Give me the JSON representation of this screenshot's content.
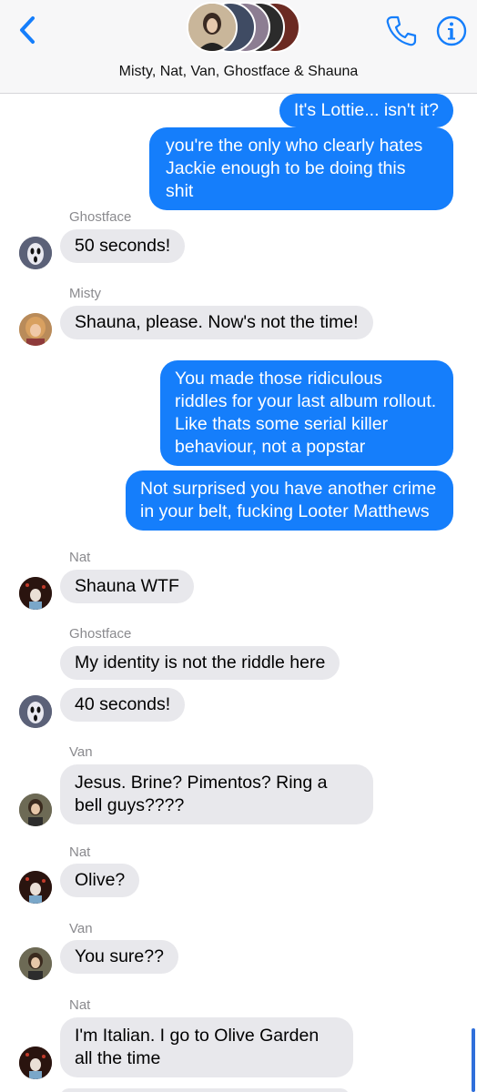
{
  "header": {
    "group_name": "Misty, Nat, Van, Ghostface & Shauna",
    "accent": "#157efb"
  },
  "icons": {
    "back": "chevron-left-icon",
    "phone": "phone-icon",
    "info": "info-icon"
  },
  "colors": {
    "outgoing_bubble": "#157efb",
    "incoming_bubble": "#e8e8ec",
    "sender_label": "#8a8a8e"
  },
  "messages": [
    {
      "direction": "outgoing",
      "text": "It's Lottie... isn't it?"
    },
    {
      "direction": "outgoing",
      "text": "you're the only who clearly hates Jackie enough to be doing this shit"
    },
    {
      "direction": "incoming",
      "sender": "Ghostface",
      "text": "50 seconds!"
    },
    {
      "direction": "incoming",
      "sender": "Misty",
      "text": "Shauna, please. Now's not the time!"
    },
    {
      "direction": "outgoing",
      "text": "You made those ridiculous riddles for your last album rollout. Like thats some serial killer behaviour, not a popstar"
    },
    {
      "direction": "outgoing",
      "text": "Not surprised you have another crime in your belt, fucking Looter Matthews"
    },
    {
      "direction": "incoming",
      "sender": "Nat",
      "text": "Shauna WTF"
    },
    {
      "direction": "incoming",
      "sender": "Ghostface",
      "text": "My identity is not the riddle here"
    },
    {
      "direction": "incoming",
      "text": "40 seconds!"
    },
    {
      "direction": "incoming",
      "sender": "Van",
      "text": "Jesus. Brine? Pimentos? Ring a bell guys????"
    },
    {
      "direction": "incoming",
      "sender": "Nat",
      "text": "Olive?"
    },
    {
      "direction": "incoming",
      "sender": "Van",
      "text": "You sure??"
    },
    {
      "direction": "incoming",
      "sender": "Nat",
      "text": "I'm Italian. I go to Olive Garden all the time"
    }
  ]
}
